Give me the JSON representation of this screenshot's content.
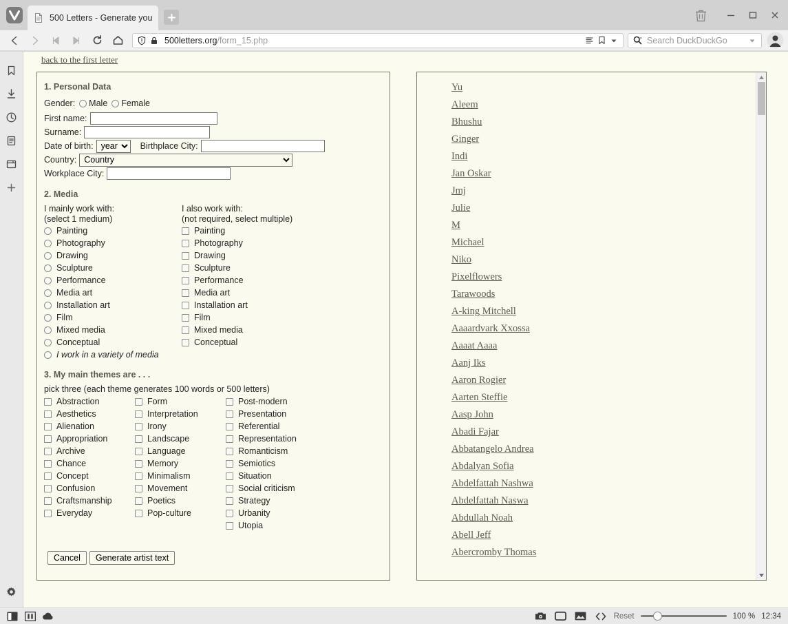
{
  "browser": {
    "name": "Vivaldi",
    "tab": {
      "title": "500 Letters - Generate you",
      "favicon": "document-icon"
    },
    "new_tab_label": "+",
    "window_controls": {
      "minimize": "–",
      "maximize": "□",
      "close": "✕"
    },
    "trash_icon": "trash-icon",
    "nav": {
      "back": "back-icon",
      "forward": "forward-icon",
      "rewind": "rewind-icon",
      "fastforward": "fastforward-icon",
      "reload": "reload-icon",
      "home": "home-icon"
    },
    "url": {
      "domain": "500letters.org",
      "path": "/form_15.php",
      "shield": "shield-icon",
      "lock": "lock-icon"
    },
    "urlbar_extras": {
      "reader": "reader-icon",
      "bookmark": "bookmark-icon",
      "dropdown": "chevron-down-icon"
    },
    "search": {
      "placeholder": "Search DuckDuckGo",
      "engine_icon": "search-icon",
      "dropdown": "chevron-down-icon"
    },
    "profile_icon": "profile-avatar-icon",
    "rail": [
      {
        "name": "bookmarks",
        "icon": "bookmark-icon"
      },
      {
        "name": "downloads",
        "icon": "download-icon"
      },
      {
        "name": "history",
        "icon": "clock-icon"
      },
      {
        "name": "notes",
        "icon": "notes-icon"
      },
      {
        "name": "windows",
        "icon": "window-icon"
      },
      {
        "name": "add-panel",
        "icon": "plus-icon"
      }
    ],
    "rail_settings": {
      "name": "settings",
      "icon": "gear-icon"
    },
    "statusbar": {
      "left_icons": [
        {
          "name": "panel-toggle",
          "icon": "panel-toggle-icon"
        },
        {
          "name": "tiling",
          "icon": "tiling-icon"
        },
        {
          "name": "sync",
          "icon": "cloud-icon"
        }
      ],
      "right_icons": [
        {
          "name": "capture-page",
          "icon": "camera-icon"
        },
        {
          "name": "page-actions",
          "icon": "rectangle-icon"
        },
        {
          "name": "images-toggle",
          "icon": "image-icon"
        },
        {
          "name": "developer-tools",
          "icon": "code-icon"
        }
      ],
      "reset_label": "Reset",
      "zoom_value": "100 %",
      "clock": "12:34"
    }
  },
  "page": {
    "back_link": "back to the first letter",
    "section1": {
      "title": "1. Personal Data",
      "gender_label": "Gender:",
      "gender_options": [
        "Male",
        "Female"
      ],
      "first_name_label": "First name:",
      "first_name_value": "",
      "surname_label": "Surname:",
      "surname_value": "",
      "dob_label": "Date of birth:",
      "dob_selected": "year",
      "birthplace_label": "Birthplace City:",
      "birthplace_value": "",
      "country_label": "Country:",
      "country_selected": "Country",
      "workplace_label": "Workplace City:",
      "workplace_value": ""
    },
    "section2": {
      "title": "2. Media",
      "main_head_1": "I mainly work with:",
      "main_head_2": "(select 1 medium)",
      "also_head_1": "I also work with:",
      "also_head_2": "(not required, select multiple)",
      "main_options": [
        "Painting",
        "Photography",
        "Drawing",
        "Sculpture",
        "Performance",
        "Media art",
        "Installation art",
        "Film",
        "Mixed media",
        "Conceptual"
      ],
      "main_variety_option": "I work in a variety of media",
      "also_options": [
        "Painting",
        "Photography",
        "Drawing",
        "Sculpture",
        "Performance",
        "Media art",
        "Installation art",
        "Film",
        "Mixed media",
        "Conceptual"
      ]
    },
    "section3": {
      "title": "3. My main themes are . . .",
      "hint": "pick three (each theme generates 100 words or 500 letters)",
      "column1": [
        "Abstraction",
        "Aesthetics",
        "Alienation",
        "Appropriation",
        "Archive",
        "Chance",
        "Concept",
        "Confusion",
        "Craftsmanship",
        "Everyday"
      ],
      "column2": [
        "Form",
        "Interpretation",
        "Irony",
        "Landscape",
        "Language",
        "Memory",
        "Minimalism",
        "Movement",
        "Poetics",
        "Pop-culture"
      ],
      "column3": [
        "Post-modern",
        "Presentation",
        "Referential",
        "Representation",
        "Romanticism",
        "Semiotics",
        "Situation",
        "Social criticism",
        "Strategy",
        "Urbanity",
        "Utopia"
      ]
    },
    "buttons": {
      "cancel": "Cancel",
      "generate": "Generate artist text"
    },
    "name_list": [
      "Yu",
      "Aleem",
      "Bhushu",
      "Ginger",
      "Indi",
      "Jan Oskar",
      "Jmj",
      "Julie",
      "M",
      "Michael",
      "Niko",
      "Pixelflowers",
      "Tarawoods",
      "A-king Mitchell",
      "Aaaardvark Xxossa",
      "Aaaat Aaaa",
      "Aanj Iks",
      "Aaron Rogier",
      "Aarten Steffie",
      "Aasp John",
      "Abadi Fajar",
      "Abbatangelo Andrea",
      "Abdalyan Sofia",
      "Abdelfattah Nashwa",
      "Abdelfattah Naswa",
      "Abdullah Noah",
      "Abell Jeff",
      "Abercromby Thomas"
    ]
  },
  "colors": {
    "page_bg": "#fbfbf0",
    "panel_bg": "#fafaef",
    "panel_border": "#7a7a6a",
    "link": "#5c5c50",
    "chrome_bg": "#f1f1f1",
    "titlebar_bg": "#d2d2d2"
  }
}
